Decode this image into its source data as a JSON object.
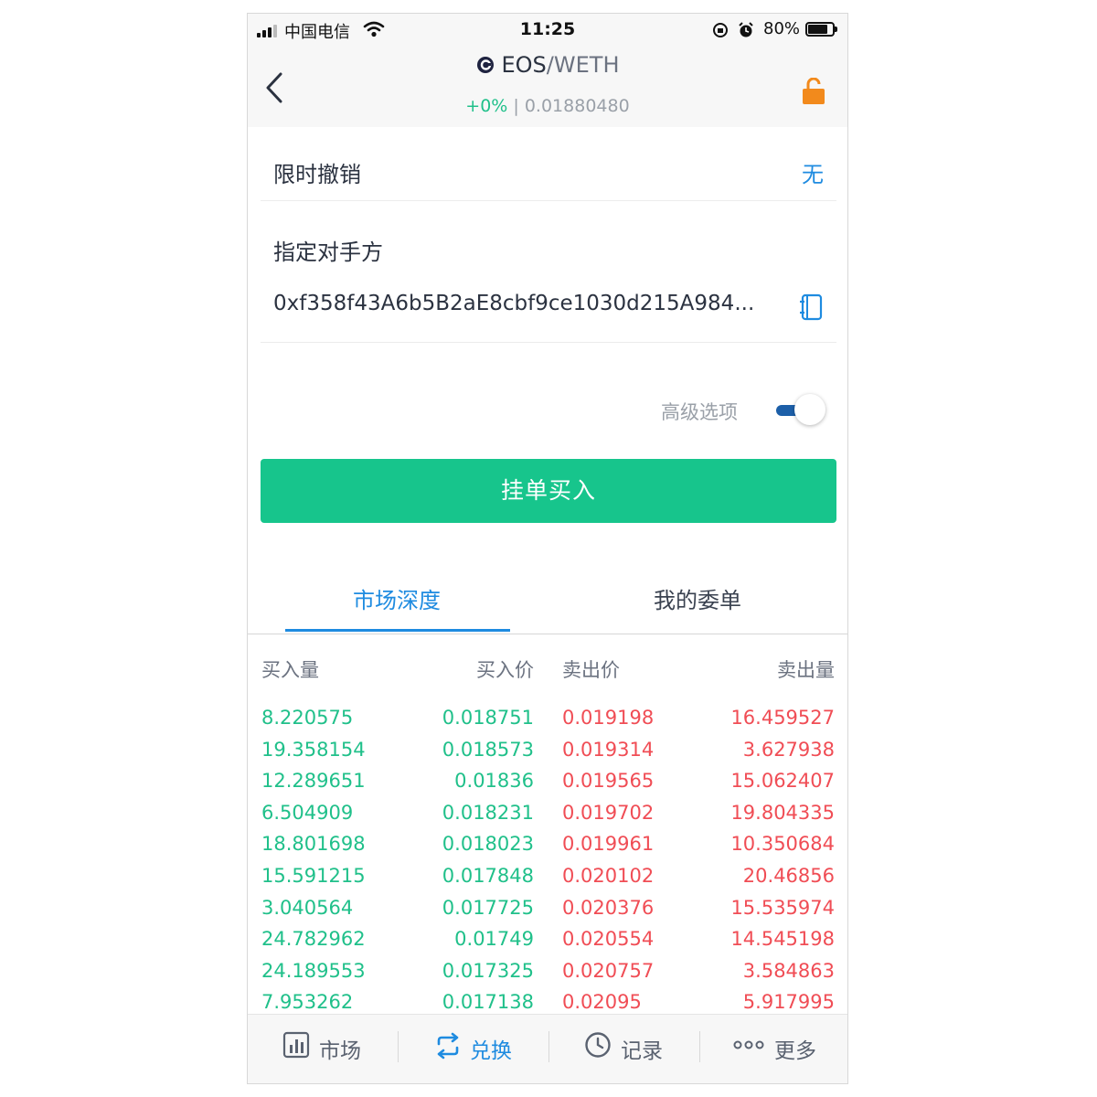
{
  "status": {
    "carrier": "中国电信",
    "time": "11:25",
    "battery_text": "80%",
    "battery_level": 0.8
  },
  "nav": {
    "base": "EOS",
    "separator": "/",
    "quote": "WETH",
    "change": "+0%",
    "divider": " | ",
    "price": "0.01880480"
  },
  "form": {
    "cancel_label": "限时撤销",
    "cancel_value": "无",
    "counterparty_label": "指定对手方",
    "counterparty_address": "0xf358f43A6b5B2aE8cbf9ce1030d215A984...",
    "advanced_label": "高级选项",
    "advanced_on": true,
    "submit_label": "挂单买入"
  },
  "tabs": [
    {
      "label": "市场深度",
      "active": true
    },
    {
      "label": "我的委单",
      "active": false
    }
  ],
  "depth": {
    "headers": {
      "bid_amount": "买入量",
      "bid_price": "买入价",
      "ask_price": "卖出价",
      "ask_amount": "卖出量"
    },
    "rows": [
      [
        "8.220575",
        "0.018751",
        "0.019198",
        "16.459527"
      ],
      [
        "19.358154",
        "0.018573",
        "0.019314",
        "3.627938"
      ],
      [
        "12.289651",
        "0.01836",
        "0.019565",
        "15.062407"
      ],
      [
        "6.504909",
        "0.018231",
        "0.019702",
        "19.804335"
      ],
      [
        "18.801698",
        "0.018023",
        "0.019961",
        "10.350684"
      ],
      [
        "15.591215",
        "0.017848",
        "0.020102",
        "20.46856"
      ],
      [
        "3.040564",
        "0.017725",
        "0.020376",
        "15.535974"
      ],
      [
        "24.782962",
        "0.01749",
        "0.020554",
        "14.545198"
      ],
      [
        "24.189553",
        "0.017325",
        "0.020757",
        "3.584863"
      ],
      [
        "7.953262",
        "0.017138",
        "0.02095",
        "5.917995"
      ]
    ]
  },
  "tabbar": [
    {
      "label": "市场",
      "icon": "bar-chart-icon",
      "active": false
    },
    {
      "label": "兑换",
      "icon": "exchange-icon",
      "active": true
    },
    {
      "label": "记录",
      "icon": "clock-icon",
      "active": false
    },
    {
      "label": "更多",
      "icon": "more-dots-icon",
      "active": false
    }
  ],
  "colors": {
    "accent": "#1e8be0",
    "buy_green": "#17c58c",
    "bid_text": "#20c08a",
    "ask_text": "#f04d55",
    "lock_orange": "#f28a1c"
  }
}
